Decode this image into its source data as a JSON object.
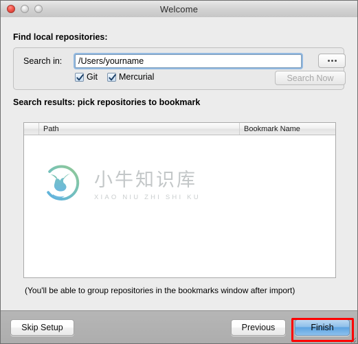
{
  "window": {
    "title": "Welcome",
    "traffic_lights": [
      "close",
      "minimize",
      "zoom"
    ]
  },
  "sections": {
    "find_title": "Find local repositories:",
    "results_title": "Search results: pick repositories to bookmark"
  },
  "search": {
    "label": "Search in:",
    "path_value": "/Users/yourname",
    "path_placeholder": "/Users/yourname",
    "browse_label": "...",
    "search_now_label": "Search Now",
    "checkboxes": [
      {
        "label": "Git",
        "checked": true
      },
      {
        "label": "Mercurial",
        "checked": true
      }
    ]
  },
  "table": {
    "columns": [
      "",
      "Path",
      "Bookmark Name"
    ],
    "rows": []
  },
  "hint": "(You'll be able to group repositories in the bookmarks window after import)",
  "footer": {
    "skip_label": "Skip Setup",
    "previous_label": "Previous",
    "finish_label": "Finish"
  },
  "watermark": {
    "cn_text": "小牛知识库",
    "en_text": "XIAO NIU ZHI SHI KU"
  },
  "colors": {
    "accent_blue": "#5ea4e2",
    "annotation_red": "#fd0000",
    "close_red": "#f2554a",
    "watermark_gray": "#c3c7c8"
  }
}
